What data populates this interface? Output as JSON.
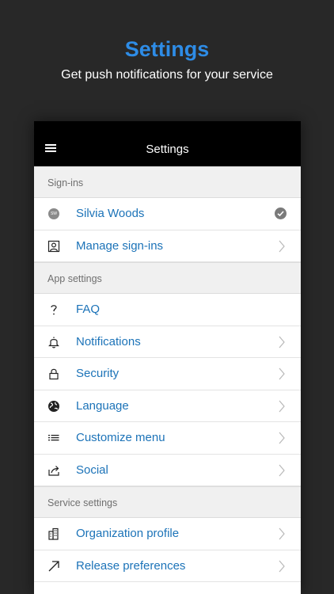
{
  "hero": {
    "title": "Settings",
    "subtitle": "Get push notifications for your service",
    "accent": "#2E8CE6"
  },
  "appbar": {
    "title": "Settings",
    "menu_icon": "hamburger-menu-icon"
  },
  "sections": {
    "signins": {
      "header": "Sign-ins",
      "items": [
        {
          "label": "Silvia Woods",
          "icon": "avatar",
          "avatar_initials": "SW",
          "trailing": "check-circle-icon"
        },
        {
          "label": "Manage sign-ins",
          "icon": "user-badge-icon",
          "trailing": "chevron-right-icon"
        }
      ]
    },
    "app": {
      "header": "App settings",
      "items": [
        {
          "label": "FAQ",
          "icon": "question-icon",
          "trailing": "none"
        },
        {
          "label": "Notifications",
          "icon": "bell-icon",
          "trailing": "chevron-right-icon"
        },
        {
          "label": "Security",
          "icon": "lock-icon",
          "trailing": "chevron-right-icon"
        },
        {
          "label": "Language",
          "icon": "globe-icon",
          "trailing": "chevron-right-icon"
        },
        {
          "label": "Customize menu",
          "icon": "list-icon",
          "trailing": "chevron-right-icon"
        },
        {
          "label": "Social",
          "icon": "share-icon",
          "trailing": "chevron-right-icon"
        }
      ]
    },
    "service": {
      "header": "Service settings",
      "items": [
        {
          "label": "Organization profile",
          "icon": "building-icon",
          "trailing": "chevron-right-icon"
        },
        {
          "label": "Release preferences",
          "icon": "arrow-up-right-icon",
          "trailing": "chevron-right-icon"
        }
      ]
    }
  },
  "colors": {
    "background": "#282828",
    "link": "#1c73b8",
    "section_bg": "#f0f0f0",
    "appbar_bg": "#000000"
  }
}
